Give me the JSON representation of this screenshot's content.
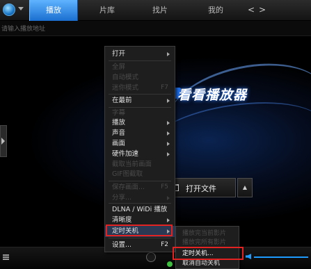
{
  "tabs": [
    "播放",
    "片库",
    "找片",
    "我的"
  ],
  "nav": {
    "prev": "<",
    "next": ">"
  },
  "address_placeholder": "请输入播放地址",
  "brand_text": "看看播放器",
  "open_file": {
    "label": "打开文件",
    "arrow": "▲"
  },
  "colors": {
    "accent": "#1a6fd0",
    "highlight_box": "#e32222",
    "menu_bg": "#1e1e1e",
    "disabled_text": "#4a4a4a"
  },
  "context_menu": {
    "open": "打开",
    "full_screen": "全屏",
    "auto_mode": "自动模式",
    "mini_mode": "迷你模式",
    "mini_mode_shortcut": "F7",
    "on_top": "在最前",
    "playlist_hidden": "字幕",
    "play": "播放",
    "audio": "声音",
    "picture": "画面",
    "hw_accel": "硬件加速",
    "screenshot": "截取当前画面",
    "gif_capture": "GIF图截取",
    "save_frame": "保存画面...",
    "save_frame_shortcut": "F5",
    "share": "分享...",
    "dlna": "DLNA / WiDi 播放",
    "clarity": "清晰度",
    "timer_shutdown": "定时关机",
    "settings": "设置...",
    "settings_shortcut": "F2"
  },
  "submenu": {
    "after_play_line1": "播放完当前影片",
    "after_play_line2": "播放完所有影片",
    "timer": "定时关机...",
    "cancel": "取消自动关机"
  },
  "icons": [
    "logo-icon",
    "dropdown-caret-icon",
    "folder-icon",
    "playlist-icon",
    "stop-icon",
    "volume-icon",
    "side-expand-icon"
  ]
}
